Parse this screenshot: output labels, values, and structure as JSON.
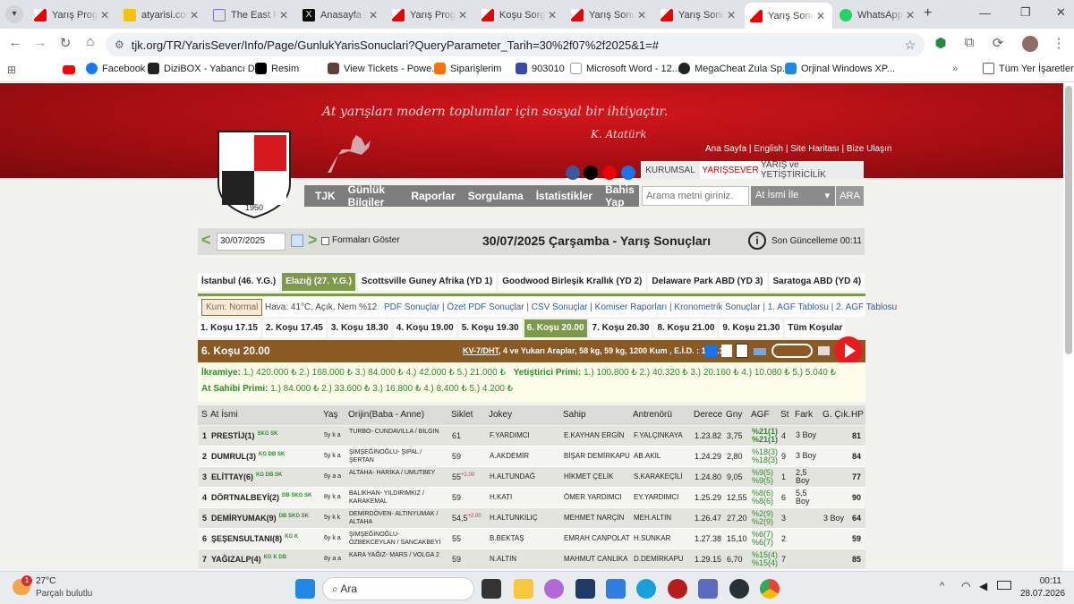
{
  "tabs": [
    {
      "title": "Yarış Program"
    },
    {
      "title": "atyarisi.com"
    },
    {
      "title": "The East P"
    },
    {
      "title": "Anasayfa /"
    },
    {
      "title": "Yarış Program"
    },
    {
      "title": "Koşu Sorgu"
    },
    {
      "title": "Yarış Sonuç"
    },
    {
      "title": "Yarış Sonuç"
    },
    {
      "title": "Yarış Sonuç"
    },
    {
      "title": "WhatsApp"
    }
  ],
  "url": "tjk.org/TR/YarisSever/Info/Page/GunlukYarisSonuclari?QueryParameter_Tarih=30%2f07%2f2025&1=#",
  "bookmarks": [
    "Facebook",
    "DiziBOX - Yabancı D...",
    "Resim",
    "View Tickets - Powe...",
    "Siparişlerim",
    "903010",
    "Microsoft Word - 12...",
    "MegaCheat Zula Sp...",
    "Orjinal Windows XP..."
  ],
  "bookmarks_folder": "Tüm Yer İşaretleri",
  "header": {
    "slogan": "At yarışları modern toplumlar için sosyal bir ihtiyaçtır.",
    "signature": "K. Atatürk",
    "year": "1950",
    "toplinks": "Ana Sayfa | English | Site Haritası | Bize Ulaşın",
    "tabs": [
      "KURUMSAL",
      "YARIŞSEVER",
      "YARIŞ ve YETİŞTİRİCİLİK"
    ],
    "nav": [
      "TJK",
      "Günlük Bilgiler",
      "Raporlar",
      "Sorgulama",
      "İstatistikler",
      "Bahis Yap"
    ],
    "search_placeholder": "Arama metni giriniz.",
    "search_scope": "At İsmi İle",
    "search_button": "ARA"
  },
  "datebar": {
    "date_input": "30/07/2025",
    "formalari": "Formaları Göster",
    "title": "30/07/2025 Çarşamba - Yarış Sonuçları",
    "updated": "Son Güncelleme 00:11"
  },
  "cities": [
    "İstanbul (46. Y.G.)",
    "Elazığ (27. Y.G.)",
    "Scottsville Guney Afrika (YD 1)",
    "Goodwood Birleşik Krallık (YD 2)",
    "Delaware Park ABD (YD 3)",
    "Saratoga ABD (YD 4)"
  ],
  "info": {
    "kum": "Kum: Normal",
    "hava": "Hava: 41°C, Açık, Nem %12",
    "links": "PDF Sonuçlar | Özet PDF Sonuçlar | CSV Sonuçlar | Komiser Raporları | Kronometrik Sonuçlar | 1. AGF Tablosu | 2. AGF Tablosu"
  },
  "races": [
    "1. Koşu 17.15",
    "2. Koşu 17.45",
    "3. Koşu 18.30",
    "4. Koşu 19.00",
    "5. Koşu 19.30",
    "6. Koşu 20.00",
    "7. Koşu 20.30",
    "8. Koşu 21.00",
    "9. Koşu 21.30",
    "Tüm Koşular"
  ],
  "race": {
    "title": "6. Koşu 20.00",
    "desc_link": "KV-7/DHT",
    "desc": ", 4 ve Yukarı Araplar, 58 kg, 59 kg, 1200 Kum , E.İ.D. : 1.21.14",
    "ikramiye_label": "İkramiye:",
    "ikramiye": "1.) 420.000 ₺  2.) 168.000 ₺  3.) 84.000 ₺  4.) 42.000 ₺  5.) 21.000 ₺",
    "yetistirici_label": "Yetiştirici Primi:",
    "yetistirici": "1.) 100.800 ₺  2.) 40.320 ₺  3.) 20.160 ₺  4.) 10.080 ₺  5.) 5.040 ₺",
    "atsahibi_label": "At Sahibi Primi:",
    "atsahibi": "1.) 84.000 ₺  2.) 33.600 ₺  3.) 16.800 ₺  4.) 8.400 ₺  5.) 4.200 ₺"
  },
  "table": {
    "headers": [
      "S",
      "At İsmi",
      "Yaş",
      "Orijin(Baba - Anne)",
      "Siklet",
      "Jokey",
      "Sahip",
      "Antrenörü",
      "Derece",
      "Gny",
      "AGF",
      "St",
      "Fark",
      "G. Çık.",
      "HP"
    ],
    "rows": [
      {
        "s": "1",
        "at": "PRESTİJ(1)",
        "tag": "SKG SK",
        "yas": "5y k a",
        "orijin": "TURBO- CUNDAVILLA / BILGIN",
        "siklet": "61",
        "sup": "",
        "jokey": "F.YARDIMCI",
        "sahip": "E.KAYHAN ERGİN",
        "antrenor": "F.YALÇINKAYA",
        "derece": "1.23.82",
        "gny": "3,75",
        "agf": "%21(1)\n%21(1)",
        "st": "4",
        "fark": "3 Boy",
        "gcik": "",
        "hp": "81"
      },
      {
        "s": "2",
        "at": "DUMRUL(3)",
        "tag": "KG DB SK",
        "yas": "5y k a",
        "orijin": "ŞİMŞEĞİNOĞLU- ŞIPAL / ŞERTAN",
        "siklet": "59",
        "sup": "",
        "jokey": "A.AKDEMİR",
        "sahip": "BİŞAR DEMİRKAPU",
        "antrenor": "AB.AKIL",
        "derece": "1.24.29",
        "gny": "2,80",
        "agf": "%18(3)\n%18(3)",
        "st": "9",
        "fark": "3 Boy",
        "gcik": "",
        "hp": "84"
      },
      {
        "s": "3",
        "at": "ELİTTAY(6)",
        "tag": "KG DB SK",
        "yas": "6y a a",
        "orijin": "ALTAHA- HARİKA / UMUTBEY",
        "siklet": "55",
        "sup": "+2.00",
        "jokey": "H.ALTUNDAĞ",
        "sahip": "HİKMET ÇELİK",
        "antrenor": "S.KARAKEÇİLİ",
        "derece": "1.24.80",
        "gny": "9,05",
        "agf": "%9(5)\n%9(5)",
        "st": "1",
        "fark": "2,5 Boy",
        "gcik": "",
        "hp": "77"
      },
      {
        "s": "4",
        "at": "DÖRTNALBEYİ(2)",
        "tag": "DB SKG SK",
        "yas": "8y k a",
        "orijin": "BALIKHAN- YILDIRIMKIZ / KARAKEMAL",
        "siklet": "59",
        "sup": "",
        "jokey": "H.KATI",
        "sahip": "ÖMER YARDIMCI",
        "antrenor": "EY.YARDIMCI",
        "derece": "1.25.29",
        "gny": "12,55",
        "agf": "%8(6)\n%8(6)",
        "st": "6",
        "fark": "5,5 Boy",
        "gcik": "",
        "hp": "90"
      },
      {
        "s": "5",
        "at": "DEMİRYUMAK(9)",
        "tag": "DB SKG SK",
        "yas": "5y k k",
        "orijin": "DEMİRDÖVEN- ALTINYUMAK / ALTAHA",
        "siklet": "54,5",
        "sup": "+2.00",
        "jokey": "H.ALTUNKILIÇ",
        "sahip": "MEHMET NARÇİN",
        "antrenor": "MEH.ALTIN",
        "derece": "1.26.47",
        "gny": "27,20",
        "agf": "%2(9)\n%2(9)",
        "st": "3",
        "fark": "",
        "gcik": "3 Boy",
        "hp": "64"
      },
      {
        "s": "6",
        "at": "ŞEŞENSULTANI(8)",
        "tag": "KG K",
        "yas": "6y k a",
        "orijin": "ŞİMŞEĞİNOĞLU- ÖZBEKCEYLAN / SANCAKBEYİ",
        "siklet": "55",
        "sup": "",
        "jokey": "B.BEKTAŞ",
        "sahip": "EMRAH CANPOLAT",
        "antrenor": "H.SUNKAR",
        "derece": "1.27.38",
        "gny": "15,10",
        "agf": "%6(7)\n%6(7)",
        "st": "2",
        "fark": "",
        "gcik": "",
        "hp": "59"
      },
      {
        "s": "7",
        "at": "YAĞIZALP(4)",
        "tag": "KG K DB",
        "yas": "8y a a",
        "orijin": "KARA YAĞIZ- MARS / VOLGA 2",
        "siklet": "59",
        "sup": "",
        "jokey": "N.ALTIN",
        "sahip": "MAHMUT CANLIKA",
        "antrenor": "D.DEMİRKAPU",
        "derece": "1.29.15",
        "gny": "6,70",
        "agf": "%15(4)\n%15(4)",
        "st": "7",
        "fark": "",
        "gcik": "",
        "hp": "85"
      }
    ]
  },
  "taskbar": {
    "temp": "27°C",
    "weather": "Parçalı bulutlu",
    "badge": "1",
    "search": "Ara",
    "time": "00:11",
    "date": "28.07.2026"
  }
}
